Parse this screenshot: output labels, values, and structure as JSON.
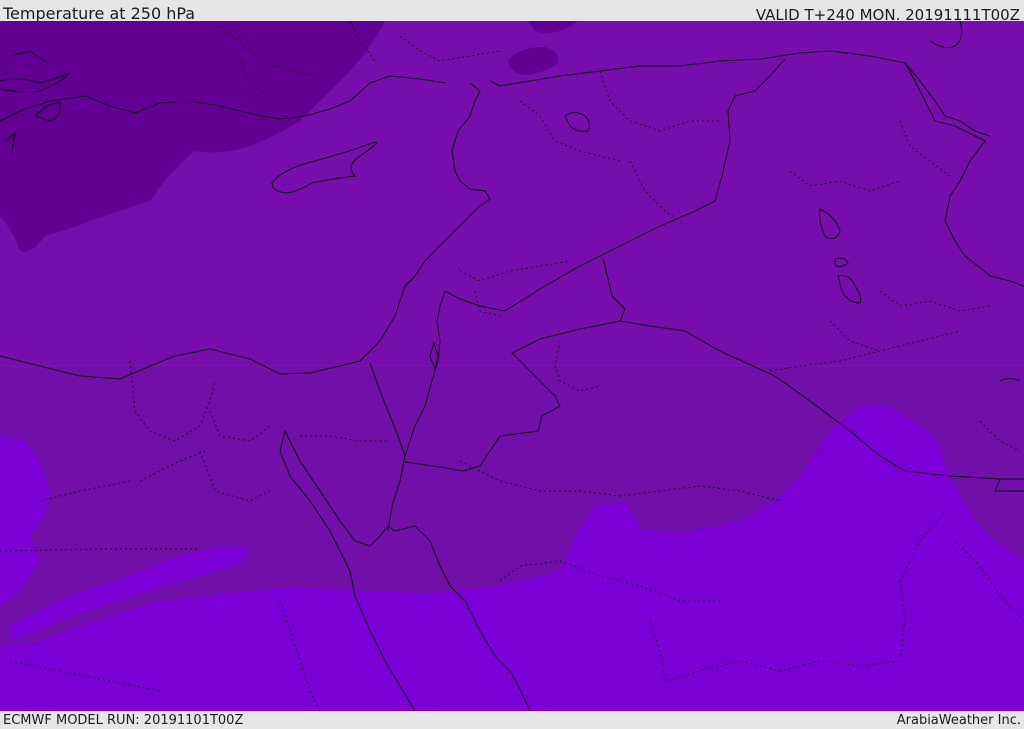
{
  "header": {
    "title": "Temperature at 250 hPa",
    "valid": "VALID T+240 MON. 20191111T00Z"
  },
  "footer": {
    "model_run": "ECMWF MODEL RUN: 20191101T00Z",
    "credit": "ArabiaWeather Inc."
  },
  "map": {
    "field": "temperature",
    "level": "250 hPa",
    "colors": {
      "coldest": "#620094",
      "cold": "#760ead",
      "mid": "#7010a8",
      "warm": "#7c00d6",
      "border": "#0d0a18"
    }
  }
}
